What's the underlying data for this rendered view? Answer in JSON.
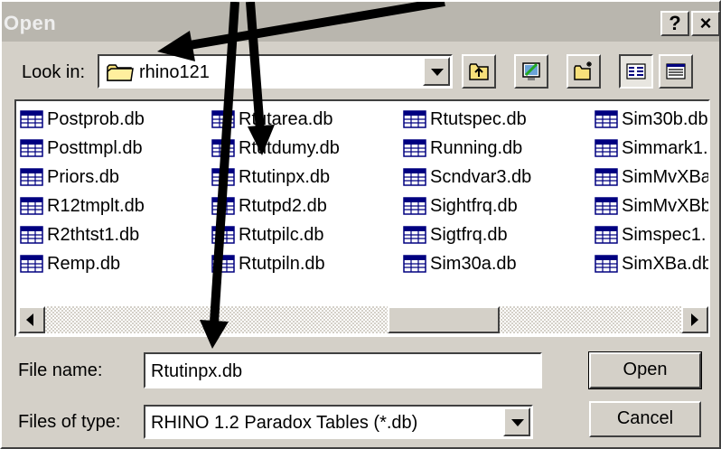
{
  "dialog": {
    "title": "Open",
    "help_button": "?",
    "close_button": "×"
  },
  "lookin": {
    "label": "Look in:",
    "value": "rhino121"
  },
  "toolbar": {
    "up_folder": "up-one-level",
    "desktop": "desktop",
    "new_folder": "create-new-folder",
    "list_view": "list-view",
    "details_view": "details-view"
  },
  "files": [
    [
      "Postprob.db",
      "Posttmpl.db",
      "Priors.db",
      "R12tmplt.db",
      "R2thtst1.db",
      "Remp.db"
    ],
    [
      "Rtutarea.db",
      "Rtutdumy.db",
      "Rtutinpx.db",
      "Rtutpd2.db",
      "Rtutpilc.db",
      "Rtutpiln.db"
    ],
    [
      "Rtutspec.db",
      "Running.db",
      "Scndvar3.db",
      "Sightfrq.db",
      "Sigtfrq.db",
      "Sim30a.db"
    ],
    [
      "Sim30b.db",
      "Simmark1.",
      "SimMvXBa",
      "SimMvXBb",
      "Simspec1.",
      "SimXBa.db"
    ]
  ],
  "filename": {
    "label": "File name:",
    "value": "Rtutinpx.db"
  },
  "filetype": {
    "label": "Files of type:",
    "value": "RHINO 1.2 Paradox Tables (*.db)"
  },
  "buttons": {
    "open": "Open",
    "cancel": "Cancel"
  },
  "colors": {
    "face": "#d4d0c8",
    "titlebar": "#b9b6ae",
    "annotation_arrow": "#000000"
  }
}
